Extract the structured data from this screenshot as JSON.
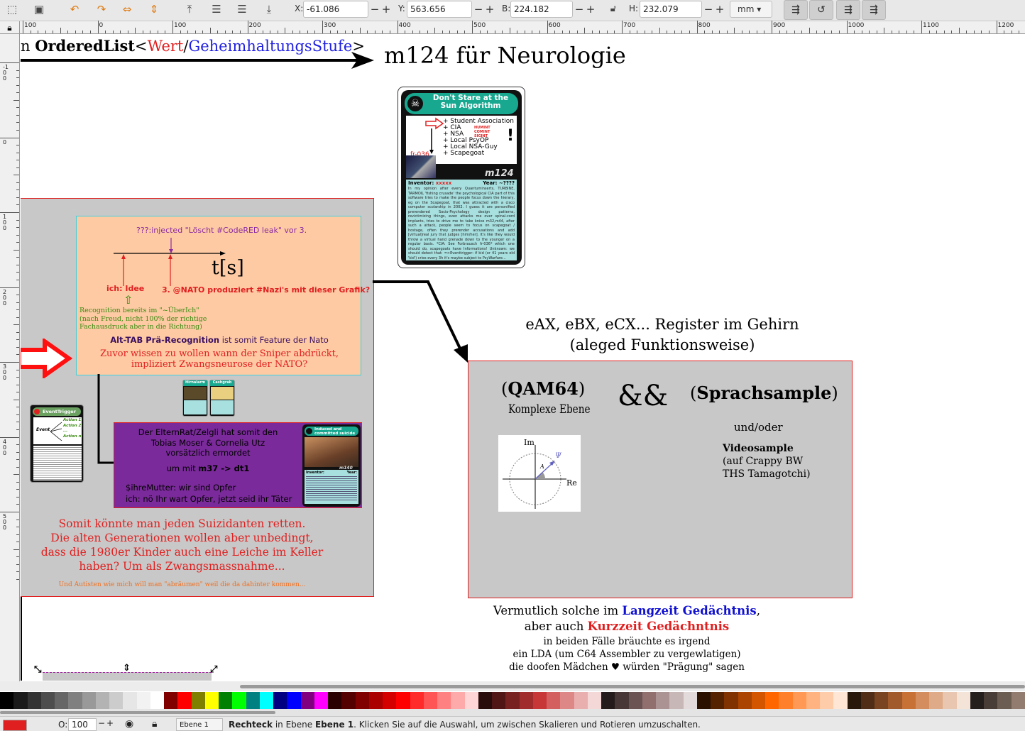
{
  "toolbar": {
    "x_label": "X:",
    "x_value": "-61.086",
    "y_label": "Y:",
    "y_value": "563.656",
    "w_label": "B:",
    "w_value": "224.182",
    "h_label": "H:",
    "h_value": "232.079",
    "unit": "mm",
    "minus": "−",
    "plus": "+"
  },
  "ruler": {
    "h_labels": [
      "100",
      "0",
      "100",
      "200",
      "300",
      "400",
      "500",
      "600",
      "700",
      "800",
      "900",
      "1000",
      "1100",
      "1200"
    ],
    "v_labels": [
      "-100",
      "0",
      "100",
      "200",
      "300",
      "400",
      "500"
    ]
  },
  "canvas": {
    "ordered_list": {
      "prefix": "n ",
      "name": "OrderedList",
      "open": "<",
      "param1": "Wert",
      "sep": "/",
      "param2": "GeheimhaltungsStufe",
      "close": ">"
    },
    "heading": "m124 für Neurologie",
    "card": {
      "title": "Don't Stare at the Sun Algorithm",
      "list": [
        "+ Student Association",
        "+ CIA",
        "+ NSA",
        "+ Local PsyOP",
        "+ Local NSA-Guy",
        "+ Scapegoat"
      ],
      "red_tags": [
        "HUMINT",
        "COMINT",
        "SIGINT"
      ],
      "exclaim": "!",
      "code": "fr-036",
      "brand": "m124",
      "inventor_label": "Inventor:",
      "inventor_value": "xxxxx",
      "year_label": "Year:",
      "year_value": "~????",
      "body": "In my opinion after every Quantuminserts, TURBINE, TARMOIL 'fishing crusade' the psychological CIA part of this software tries to make the people focus down the hierary, eg on the Scapegoat, that was attracted with a cisco computer scolarship in 2002. I guess it are personified prerendered Socio-Psychology design patterns, revictimizing things, even attacks me over spinal-cord implants, tries to drive me to take knive m32,m44, after such a attack, people seem to focus on scapegoat / hostage, often they prerender accusations and add [virtual]real jury that judges [him/her]. It's like they would throw a virtual hand grenade down to the younger on a regular basis. *CIA: See Forbrausch fr-036* which one should do, scapegoats have Informations! Unknown: we should detect that: =>Eventtrigger: if kid (or 41 years old 'kid') cries every 3h it's maybe subject to PsyWarfare..."
    },
    "timeline": {
      "top_label": "???:injected \"Löscht #CodeRED leak\" vor 3.",
      "axis_label": "t[s]",
      "label_idea": "ich: Idee",
      "label_nato": "3. @NATO produziert #Nazi's mit dieser Grafik?",
      "recognition_lines": [
        "Recognition bereits im \"~ÜberIch\"",
        "(nach Freud, nicht 100% der richtige",
        "Fachausdruck aber in die Richtung)"
      ],
      "alttab_bold": "Alt-TAB Prä-Recognition",
      "alttab_rest": " ist somit Feature der Nato",
      "sniper_lines": [
        "Zuvor wissen zu wollen wann der Sniper abdrückt,",
        "impliziert Zwangsneurose der NATO?"
      ]
    },
    "mini_cards": {
      "left": "Hirnalarm",
      "right": "Cashgrab"
    },
    "event_card": {
      "title": "EventTrigger",
      "event": "Event",
      "actions": [
        "Action 1",
        "Action 2",
        "...",
        "Action n"
      ]
    },
    "purple_box": {
      "lines": [
        "Der ElternRat/Zelgli hat somit den",
        "Tobias Moser & Cornelia Utz",
        "vorsätzlich ermordet"
      ],
      "m37_prefix": "um mit ",
      "m37_bold": "m37 -> dt1",
      "mother_lines": [
        "$ihreMutter: wir sind Opfer",
        "ich: nö Ihr wart Opfer, jetzt seid ihr Täter"
      ],
      "card_title": "Induced and committed suicide",
      "card_brand": "m140",
      "card_inventor": "Inventor:",
      "card_year": "Year:"
    },
    "suicide_lines": [
      "Somit könnte man jeden Suizidanten retten.",
      "Die alten Generationen wollen aber unbedingt,",
      "dass die 1980er Kinder auch eine Leiche im Keller",
      "haben? Um als Zwangsmassnahme..."
    ],
    "autisten_line": "Und Autisten wie mich will man \"abräumen\" weil die da dahinter kommen...",
    "register_lines": [
      "eAX, eBX, eCX... Register im Gehirn",
      "(aleged Funktionsweise)"
    ],
    "qam": {
      "open": "(",
      "name": "QAM64",
      "close": ")",
      "sub": "Komplexe Ebene",
      "amp": "&&",
      "s_open": "(",
      "s_name": "Sprachsample",
      "s_close": ")",
      "undoder": "und/oder",
      "video_bold": "Videosample",
      "video_lines": [
        "(auf Crappy BW",
        "THS Tamagotchi)"
      ],
      "im": "Im",
      "re": "Re",
      "psi": "Ψ",
      "a": "A"
    },
    "memory": {
      "l1_pre": "Vermutlich solche im ",
      "l1_blue": "Langzeit Gedächtnis",
      "l1_post": ",",
      "l2_pre": "aber auch ",
      "l2_red": "Kurzzeit Gedächntnis",
      "lines": [
        "in beiden Fälle bräuchte es irgend",
        "ein LDA (um C64 Assembler zu vergewlatigen)",
        "die doofen Mädchen ♥ würden \"Prägung\" sagen"
      ]
    }
  },
  "palette": [
    "#000000",
    "#1a1a1a",
    "#333333",
    "#4d4d4d",
    "#666666",
    "#808080",
    "#999999",
    "#b3b3b3",
    "#cccccc",
    "#e6e6e6",
    "#f2f2f2",
    "#ffffff",
    "#800000",
    "#ff0000",
    "#808000",
    "#ffff00",
    "#008000",
    "#00ff00",
    "#008080",
    "#00ffff",
    "#000080",
    "#0000ff",
    "#800080",
    "#ff00ff",
    "#2b0000",
    "#550000",
    "#800000",
    "#aa0000",
    "#d40000",
    "#ff0000",
    "#ff2a2a",
    "#ff5555",
    "#ff8080",
    "#ffaaaa",
    "#ffd5d5",
    "#280b0b",
    "#501616",
    "#782121",
    "#a02c2c",
    "#c83737",
    "#d35f5f",
    "#de8787",
    "#e9afaf",
    "#f4d7d7",
    "#241c1c",
    "#483737",
    "#6c5353",
    "#916f6f",
    "#ac9393",
    "#c8b7b7",
    "#e3dbdb",
    "#2b1100",
    "#552200",
    "#803300",
    "#aa4400",
    "#d45500",
    "#ff6600",
    "#ff7f2a",
    "#ff9955",
    "#ffb380",
    "#ffccaa",
    "#ffe6d5",
    "#28170b",
    "#502d16",
    "#784421",
    "#a05a2c",
    "#c87137",
    "#d38d5f",
    "#deaa87",
    "#e9c6af",
    "#f4e3d7",
    "#241f1c",
    "#483e37",
    "#6c5d53",
    "#917c6f"
  ],
  "status": {
    "o_label": "O:",
    "o_value": "100",
    "layer": "Ebene 1",
    "msg_bold": "Rechteck",
    "msg_mid": " in Ebene ",
    "msg_layer": "Ebene 1",
    "msg_rest": ". Klicken Sie auf die Auswahl, um zwischen Skalieren und Rotieren umzuschalten."
  }
}
